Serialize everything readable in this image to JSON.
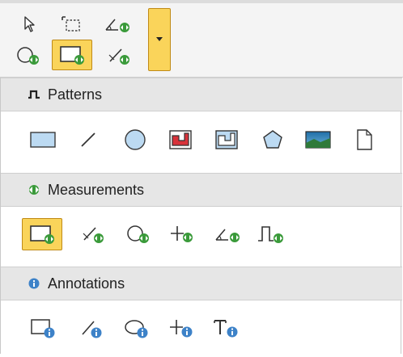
{
  "toolbar": {
    "icons": [
      "pointer-arrow-icon",
      "marquee-select-icon",
      "angle-measure-icon",
      "circle-measure-icon",
      "rectangle-measure-icon",
      "line-measure-icon"
    ],
    "selected": "rectangle-measure-icon",
    "dropdown_icon": "caret-down-icon"
  },
  "sections": [
    {
      "title": "Patterns",
      "icon": "pulse-wave-icon",
      "items": [
        "rectangle-pattern-icon",
        "line-pattern-icon",
        "circle-pattern-icon",
        "step-profile-red-icon",
        "step-profile-icon",
        "pentagon-pattern-icon",
        "image-pattern-icon",
        "document-pattern-icon"
      ]
    },
    {
      "title": "Measurements",
      "icon": "measure-arrows-icon",
      "items": [
        "rectangle-measure-icon",
        "line-measure-icon",
        "circle-measure-icon",
        "point-measure-icon",
        "angle-measure-icon",
        "profile-measure-icon"
      ],
      "selected": "rectangle-measure-icon"
    },
    {
      "title": "Annotations",
      "icon": "info-icon",
      "items": [
        "rectangle-annotation-icon",
        "line-annotation-icon",
        "circle-annotation-icon",
        "point-annotation-icon",
        "text-annotation-icon"
      ]
    }
  ],
  "colors": {
    "accent_yellow": "#fad45a",
    "accent_border": "#c08a16",
    "measure_green": "#3a9a3a",
    "info_blue": "#3d82c8",
    "header_bg": "#e6e6e6"
  }
}
